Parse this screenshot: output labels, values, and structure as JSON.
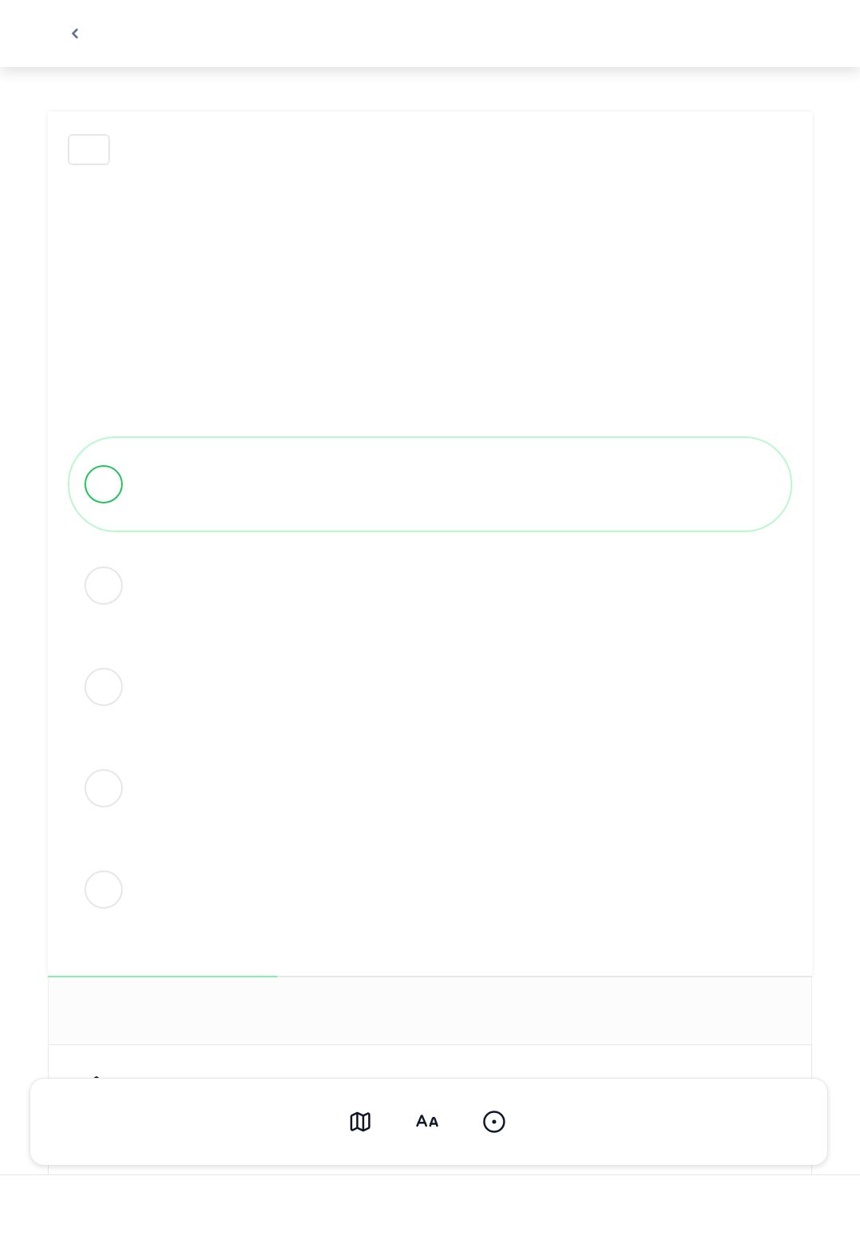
{
  "options": [
    {
      "selected": true
    },
    {
      "selected": false
    },
    {
      "selected": false
    },
    {
      "selected": false
    },
    {
      "selected": false
    }
  ],
  "progress": {
    "level": 0.3
  },
  "toolbar": [
    {
      "kind": "map"
    },
    {
      "kind": "font"
    },
    {
      "kind": "target"
    }
  ]
}
